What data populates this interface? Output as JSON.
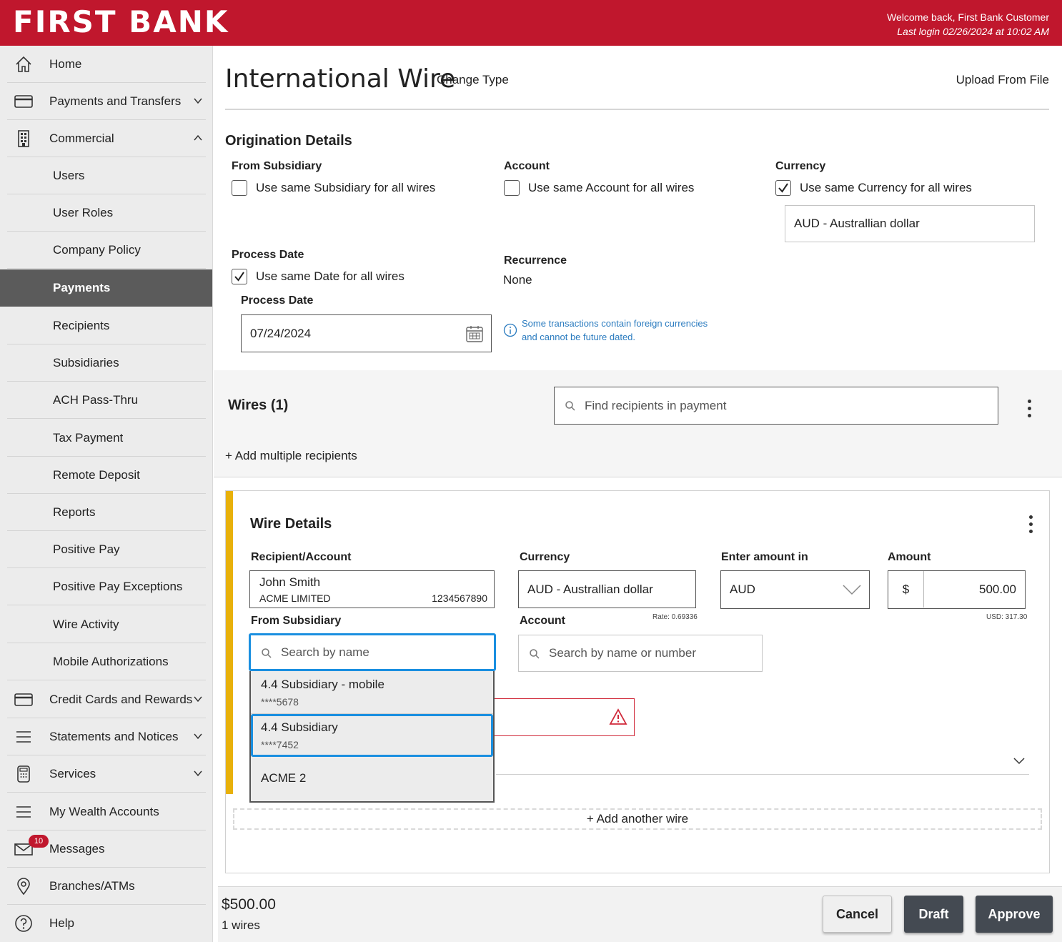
{
  "header": {
    "brand": "FIRST BANK",
    "welcome": "Welcome back, First Bank Customer",
    "last_login": "Last login 02/26/2024 at 10:02 AM",
    "color": "#c0172d"
  },
  "sidebar": {
    "items": [
      {
        "label": "Home",
        "icon": "home-icon"
      },
      {
        "label": "Payments and Transfers",
        "icon": "card-icon"
      },
      {
        "label": "Commercial",
        "icon": "building-icon"
      },
      {
        "label": "Users"
      },
      {
        "label": "User Roles"
      },
      {
        "label": "Company Policy"
      },
      {
        "label": "Payments"
      },
      {
        "label": "Recipients"
      },
      {
        "label": "Subsidiaries"
      },
      {
        "label": "ACH Pass-Thru"
      },
      {
        "label": "Tax Payment"
      },
      {
        "label": "Remote Deposit"
      },
      {
        "label": "Reports"
      },
      {
        "label": "Positive Pay"
      },
      {
        "label": "Positive Pay Exceptions"
      },
      {
        "label": "Wire Activity"
      },
      {
        "label": "Mobile Authorizations"
      },
      {
        "label": "Credit Cards and Rewards",
        "icon": "card-icon"
      },
      {
        "label": "Statements and Notices",
        "icon": "menu-icon"
      },
      {
        "label": "Services",
        "icon": "calculator-icon"
      },
      {
        "label": "My Wealth Accounts",
        "icon": "menu-icon"
      },
      {
        "label": "Messages",
        "icon": "envelope-icon",
        "badge": "10"
      },
      {
        "label": "Branches/ATMs",
        "icon": "location-pin-icon"
      },
      {
        "label": "Help",
        "icon": "help-icon"
      }
    ]
  },
  "page": {
    "title": "International Wire",
    "change_type": "Change Type",
    "upload": "Upload From File"
  },
  "origination": {
    "title": "Origination Details",
    "from_subsidiary_label": "From Subsidiary",
    "from_subsidiary_cb": "Use same Subsidiary for all wires",
    "account_label": "Account",
    "account_cb": "Use same Account for all wires",
    "currency_label": "Currency",
    "currency_cb": "Use same Currency for all wires",
    "currency_value": "AUD - Australlian dollar",
    "process_date_label": "Process Date",
    "process_date_cb": "Use same Date for all wires",
    "process_date_field_label": "Process Date",
    "process_date_value": "07/24/2024",
    "recurrence_label": "Recurrence",
    "recurrence_value": "None",
    "info_line1": "Some transactions contain foreign currencies",
    "info_line2": "and cannot be future dated."
  },
  "wires": {
    "title": "Wires (1)",
    "search_placeholder": "Find recipients in payment",
    "add_multiple": "+ Add multiple recipients"
  },
  "wire_details": {
    "title": "Wire Details",
    "recipient_label": "Recipient/Account",
    "recipient_name": "John Smith",
    "recipient_company": "ACME LIMITED",
    "recipient_account": "1234567890",
    "currency_label": "Currency",
    "currency_value": "AUD - Australlian dollar",
    "rate": "Rate: 0.69336",
    "enter_amount_label": "Enter amount in",
    "enter_amount_value": "AUD",
    "amount_label": "Amount",
    "amount_symbol": "$",
    "amount_value": "500.00",
    "usd": "USD: 317.30",
    "from_subsidiary_label": "From Subsidiary",
    "subsidiary_search_placeholder": "Search by name",
    "account_label": "Account",
    "account_search_placeholder": "Search by name or number",
    "dropdown": [
      {
        "name": "4.4 Subsidiary - mobile",
        "number": "****5678"
      },
      {
        "name": "4.4 Subsidiary",
        "number": "****7452"
      },
      {
        "name": "ACME 2",
        "number": ""
      }
    ],
    "add_another": "+ Add another wire"
  },
  "footer": {
    "total": "$500.00",
    "count": "1 wires",
    "cancel": "Cancel",
    "draft": "Draft",
    "approve": "Approve"
  }
}
